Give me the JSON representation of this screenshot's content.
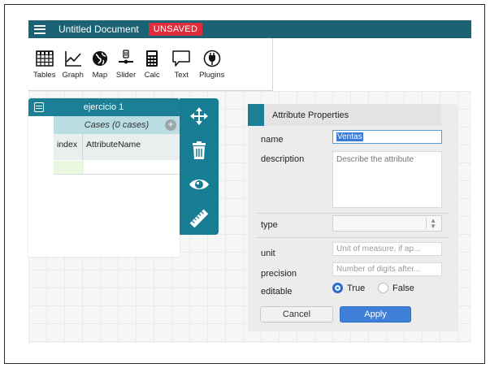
{
  "header": {
    "menu_icon": "hamburger-menu-icon",
    "title": "Untitled Document",
    "status_badge": "UNSAVED",
    "background": "#1b6374",
    "badge_color": "#e02d3c"
  },
  "toolbar": {
    "tools": [
      {
        "label": "Tables",
        "icon": "table-icon"
      },
      {
        "label": "Graph",
        "icon": "graph-icon"
      },
      {
        "label": "Map",
        "icon": "globe-icon"
      },
      {
        "label": "Slider",
        "icon": "slider-icon"
      },
      {
        "label": "Calc",
        "icon": "calculator-icon"
      },
      {
        "label": "Text",
        "icon": "speech-bubble-icon"
      },
      {
        "label": "Plugins",
        "icon": "plug-icon"
      }
    ]
  },
  "case_table": {
    "title": "ejercicio 1",
    "cases_label": "Cases (0 cases)",
    "columns": [
      "index",
      "AttributeName"
    ],
    "accent": "#1b7f95"
  },
  "inspector": {
    "buttons": [
      "move-arrows-icon",
      "trash-icon",
      "eye-icon",
      "ruler-icon"
    ],
    "color": "#177d93"
  },
  "attribute_dialog": {
    "title": "Attribute Properties",
    "fields": {
      "name_label": "name",
      "name_value": "Ventas",
      "description_label": "description",
      "description_placeholder": "Describe the attribute",
      "type_label": "type",
      "type_value": "",
      "unit_label": "unit",
      "unit_placeholder": "Unit of measure, if ap...",
      "precision_label": "precision",
      "precision_placeholder": "Number of digits after...",
      "editable_label": "editable",
      "editable_true": "True",
      "editable_false": "False",
      "editable_selected": "True"
    },
    "cancel_label": "Cancel",
    "apply_label": "Apply",
    "apply_color": "#3d7fd9"
  }
}
